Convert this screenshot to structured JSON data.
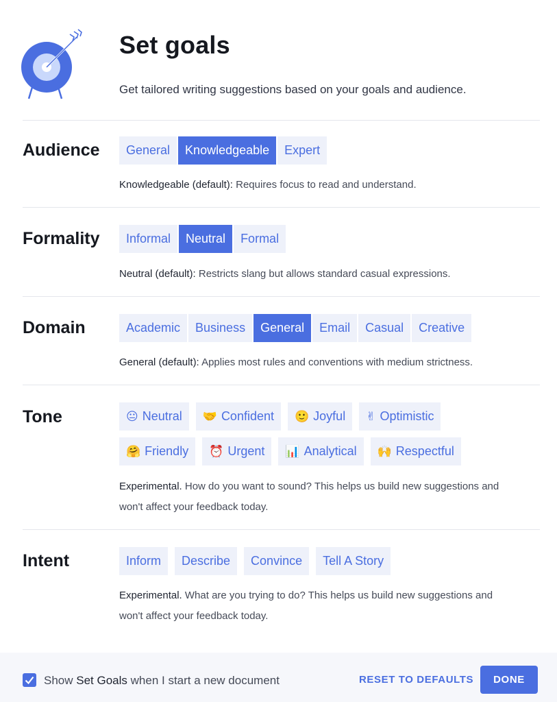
{
  "header": {
    "title": "Set goals",
    "subtitle": "Get tailored writing suggestions based on your goals and audience.",
    "icon": "target-arrow-icon"
  },
  "colors": {
    "accent": "#4a6ee0",
    "chip_bg": "#eef1fa",
    "text_dark": "#15181f",
    "divider": "#e4e6ec"
  },
  "audience": {
    "label": "Audience",
    "options": [
      "General",
      "Knowledgeable",
      "Expert"
    ],
    "selected": "Knowledgeable",
    "desc_strong": "Knowledgeable (default):",
    "desc_text": " Requires focus to read and understand."
  },
  "formality": {
    "label": "Formality",
    "options": [
      "Informal",
      "Neutral",
      "Formal"
    ],
    "selected": "Neutral",
    "desc_strong": "Neutral (default):",
    "desc_text": " Restricts slang but allows standard casual expressions."
  },
  "domain": {
    "label": "Domain",
    "options": [
      "Academic",
      "Business",
      "General",
      "Email",
      "Casual",
      "Creative"
    ],
    "selected": "General",
    "desc_strong": "General (default):",
    "desc_text": " Applies most rules and conventions with medium strictness."
  },
  "tone": {
    "label": "Tone",
    "options": [
      {
        "emoji": "😐",
        "icon": "neutral-face-icon",
        "label": "Neutral"
      },
      {
        "emoji": "🤝",
        "icon": "handshake-icon",
        "label": "Confident"
      },
      {
        "emoji": "🙂",
        "icon": "smiling-face-icon",
        "label": "Joyful"
      },
      {
        "emoji": "✌",
        "icon": "victory-hand-icon",
        "label": "Optimistic"
      },
      {
        "emoji": "🤗",
        "icon": "hugging-face-icon",
        "label": "Friendly"
      },
      {
        "emoji": "⏰",
        "icon": "alarm-clock-icon",
        "label": "Urgent"
      },
      {
        "emoji": "📊",
        "icon": "bar-chart-icon",
        "label": "Analytical"
      },
      {
        "emoji": "🙌",
        "icon": "raised-hands-icon",
        "label": "Respectful"
      }
    ],
    "desc_strong": "Experimental.",
    "desc_line1": " How do you want to sound? This helps us build new suggestions and",
    "desc_line2": "won't affect your feedback today."
  },
  "intent": {
    "label": "Intent",
    "options": [
      "Inform",
      "Describe",
      "Convince",
      "Tell A Story"
    ],
    "desc_strong": "Experimental.",
    "desc_line1": " What are you trying to do? This helps us build new suggestions and",
    "desc_line2": "won't affect your feedback today."
  },
  "footer": {
    "checkbox_checked": true,
    "show_prefix": "Show ",
    "show_strong": "Set Goals",
    "show_suffix": " when I start a new document",
    "reset_label": "RESET TO DEFAULTS",
    "done_label": "DONE"
  }
}
